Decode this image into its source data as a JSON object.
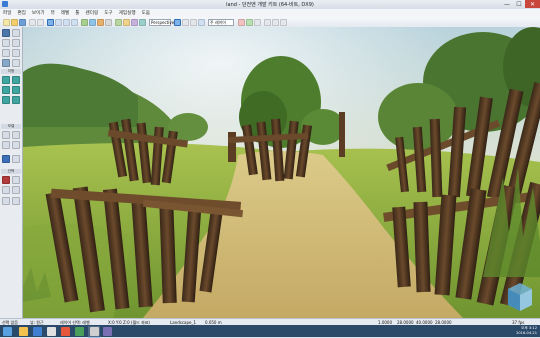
{
  "window": {
    "title": "land - 던전앤 개발 키트 (64-비트, DX9)",
    "controls": {
      "minimize": "—",
      "maximize": "☐",
      "close": "✕"
    }
  },
  "menu": [
    "파일",
    "편집",
    "보이기",
    "뷰",
    "레벨",
    "툴",
    "렌더링",
    "도구",
    "게임실행",
    "도움"
  ],
  "toolbar": {
    "viewport_field": "Perspective",
    "layer_field": "주 레이어"
  },
  "left_panel": {
    "section_a": "지형",
    "section_b": "모델",
    "section_c": "선택"
  },
  "viewport": {
    "scene": "forest path with log fences",
    "sky_color": "#d8dfc9",
    "grass_color": "#7fa43a",
    "path_color": "#cdb46e"
  },
  "status": {
    "left": "선택 없음",
    "mode": "뷰: 원근",
    "middle": "레이어 선택: 레벨",
    "coords": "X:0 Y:0 Z:0 (월드 좌표)",
    "level": "Landscape_1",
    "snap": "0.050 m",
    "right_a": "1.0000",
    "right_b": "28.0000",
    "right_c": "40.0000",
    "right_d": "28.0000",
    "fps": "37 fps"
  },
  "taskbar": {
    "time": "오후 3:12",
    "date": "2016-04-21"
  }
}
